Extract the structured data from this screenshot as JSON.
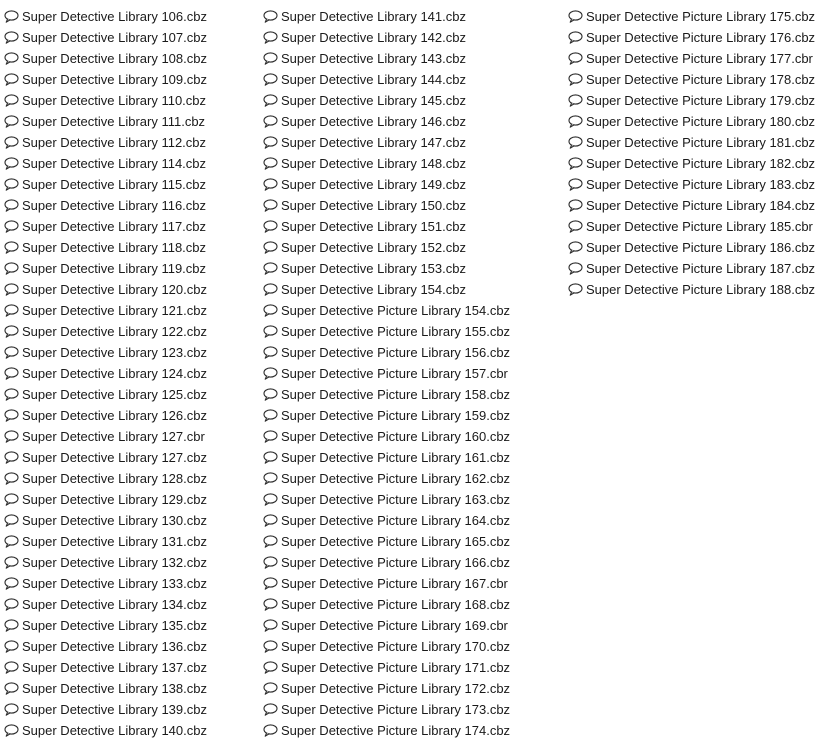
{
  "icon": "speech-bubble-icon",
  "columns": [
    {
      "files": [
        "Super Detective Library 106.cbz",
        "Super Detective Library 107.cbz",
        "Super Detective Library 108.cbz",
        "Super Detective Library 109.cbz",
        "Super Detective Library 110.cbz",
        "Super Detective Library 111.cbz",
        "Super Detective Library 112.cbz",
        "Super Detective Library 114.cbz",
        "Super Detective Library 115.cbz",
        "Super Detective Library 116.cbz",
        "Super Detective Library 117.cbz",
        "Super Detective Library 118.cbz",
        "Super Detective Library 119.cbz",
        "Super Detective Library 120.cbz",
        "Super Detective Library 121.cbz",
        "Super Detective Library 122.cbz",
        "Super Detective Library 123.cbz",
        "Super Detective Library 124.cbz",
        "Super Detective Library 125.cbz",
        "Super Detective Library 126.cbz",
        "Super Detective Library 127.cbr",
        "Super Detective Library 127.cbz",
        "Super Detective Library 128.cbz",
        "Super Detective Library 129.cbz",
        "Super Detective Library 130.cbz",
        "Super Detective Library 131.cbz",
        "Super Detective Library 132.cbz",
        "Super Detective Library 133.cbz",
        "Super Detective Library 134.cbz",
        "Super Detective Library 135.cbz",
        "Super Detective Library 136.cbz",
        "Super Detective Library 137.cbz",
        "Super Detective Library 138.cbz",
        "Super Detective Library 139.cbz",
        "Super Detective Library 140.cbz"
      ]
    },
    {
      "files": [
        "Super Detective Library 141.cbz",
        "Super Detective Library 142.cbz",
        "Super Detective Library 143.cbz",
        "Super Detective Library 144.cbz",
        "Super Detective Library 145.cbz",
        "Super Detective Library 146.cbz",
        "Super Detective Library 147.cbz",
        "Super Detective Library 148.cbz",
        "Super Detective Library 149.cbz",
        "Super Detective Library 150.cbz",
        "Super Detective Library 151.cbz",
        "Super Detective Library 152.cbz",
        "Super Detective Library 153.cbz",
        "Super Detective Library 154.cbz",
        "Super Detective Picture Library 154.cbz",
        "Super Detective Picture Library 155.cbz",
        "Super Detective Picture Library 156.cbz",
        "Super Detective Picture Library 157.cbr",
        "Super Detective Picture Library 158.cbz",
        "Super Detective Picture Library 159.cbz",
        "Super Detective Picture Library 160.cbz",
        "Super Detective Picture Library 161.cbz",
        "Super Detective Picture Library 162.cbz",
        "Super Detective Picture Library 163.cbz",
        "Super Detective Picture Library 164.cbz",
        "Super Detective Picture Library 165.cbz",
        "Super Detective Picture Library 166.cbz",
        "Super Detective Picture Library 167.cbr",
        "Super Detective Picture Library 168.cbz",
        "Super Detective Picture Library 169.cbr",
        "Super Detective Picture Library 170.cbz",
        "Super Detective Picture Library 171.cbz",
        "Super Detective Picture Library 172.cbz",
        "Super Detective Picture Library 173.cbz",
        "Super Detective Picture Library 174.cbz"
      ]
    },
    {
      "files": [
        "Super Detective Picture Library 175.cbz",
        "Super Detective Picture Library 176.cbz",
        "Super Detective Picture Library 177.cbr",
        "Super Detective Picture Library 178.cbz",
        "Super Detective Picture Library 179.cbz",
        "Super Detective Picture Library 180.cbz",
        "Super Detective Picture Library 181.cbz",
        "Super Detective Picture Library 182.cbz",
        "Super Detective Picture Library 183.cbz",
        "Super Detective Picture Library 184.cbz",
        "Super Detective Picture Library 185.cbr",
        "Super Detective Picture Library 186.cbz",
        "Super Detective Picture Library 187.cbz",
        "Super Detective Picture Library 188.cbz"
      ]
    }
  ]
}
